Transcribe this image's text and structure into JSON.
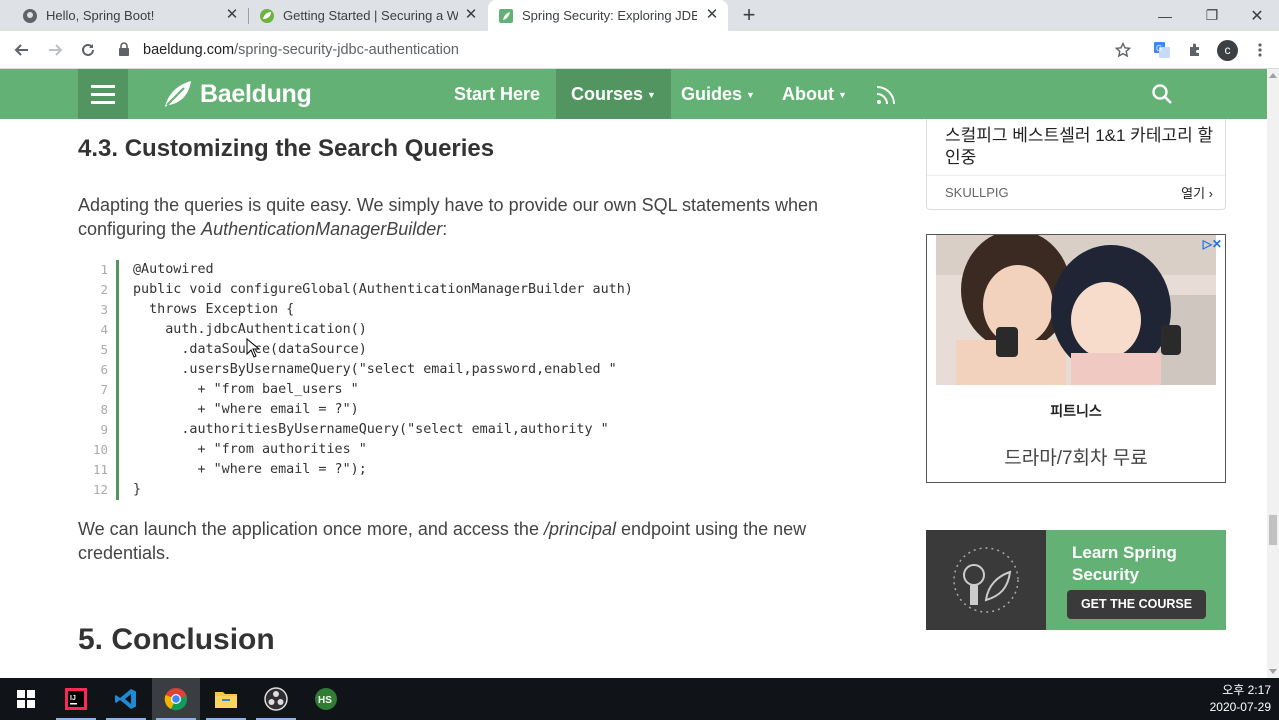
{
  "browser": {
    "tabs": [
      {
        "title": "Hello, Spring Boot!",
        "icon": "github-icon"
      },
      {
        "title": "Getting Started | Securing a We",
        "icon": "spring-leaf-icon"
      },
      {
        "title": "Spring Security: Exploring JDBC",
        "icon": "baeldung-icon",
        "active": true
      }
    ],
    "url_domain": "baeldung.com",
    "url_path": "/spring-security-jdbc-authentication",
    "profile_initial": "c"
  },
  "site": {
    "logo": "Baeldung",
    "nav": [
      {
        "label": "Start Here",
        "caret": ""
      },
      {
        "label": "Courses",
        "caret": "▼"
      },
      {
        "label": "Guides",
        "caret": "▼"
      },
      {
        "label": "About",
        "caret": "▼"
      }
    ],
    "brand_color": "#63b175",
    "brand_dark": "#529561"
  },
  "article": {
    "section_heading": "4.3. Customizing the Search Queries",
    "para1_before": "Adapting the queries is quite easy. We simply have to provide our own SQL statements when configuring the ",
    "para1_em": "AuthenticationManagerBuilder",
    "para1_after": ":",
    "code_lines": [
      "@Autowired",
      "public void configureGlobal(AuthenticationManagerBuilder auth)",
      "  throws Exception {",
      "    auth.jdbcAuthentication()",
      "      .dataSource(dataSource)",
      "      .usersByUsernameQuery(\"select email,password,enabled \"",
      "        + \"from bael_users \"",
      "        + \"where email = ?\")",
      "      .authoritiesByUsernameQuery(\"select email,authority \"",
      "        + \"from authorities \"",
      "        + \"where email = ?\");",
      "}"
    ],
    "line_numbers": [
      "1",
      "2",
      "3",
      "4",
      "5",
      "6",
      "7",
      "8",
      "9",
      "10",
      "11",
      "12"
    ],
    "para2_before": "We can launch the application once more, and access the ",
    "para2_em": "/principal",
    "para2_after": " endpoint using the new credentials.",
    "conclusion_heading": "5. Conclusion"
  },
  "sidebar": {
    "ad1": {
      "title": "스컬피그 베스트셀러 1&1 카테고리 할인중",
      "brand": "SKULLPIG",
      "cta": "열기"
    },
    "ad2": {
      "name": "피트니스",
      "subtitle": "드라마/7회차 무료"
    },
    "ad3": {
      "title": "Learn Spring Security",
      "button": "GET THE COURSE"
    }
  },
  "taskbar": {
    "apps": [
      "windows-start-icon",
      "intellij-icon",
      "vscode-icon",
      "chrome-icon",
      "file-explorer-icon",
      "obs-icon",
      "hs-app-icon"
    ],
    "time": "오후 2:17",
    "date": "2020-07-29"
  }
}
